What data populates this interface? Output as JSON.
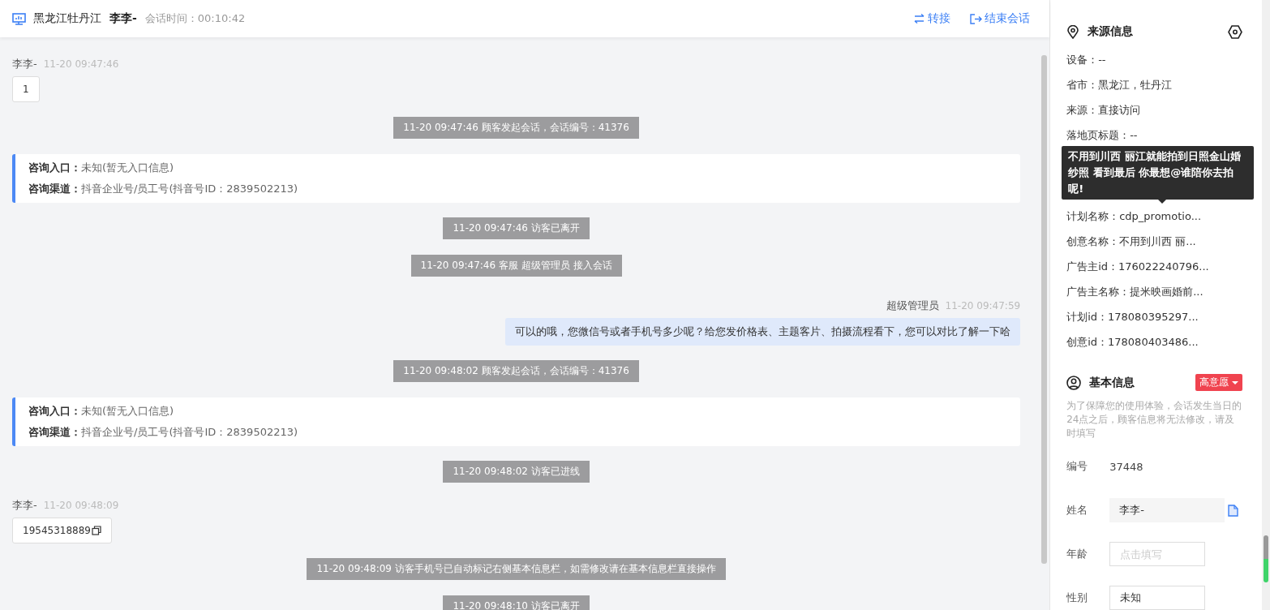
{
  "header": {
    "location": "黑龙江牡丹江",
    "visitor": "李李-",
    "duration_label": "会话时间：",
    "duration": "00:10:42",
    "actions": [
      {
        "kind": "transfer",
        "label": "转接"
      },
      {
        "kind": "end",
        "label": "结束会话"
      }
    ]
  },
  "messages": [
    {
      "kind": "visitor",
      "name": "李李-",
      "time": "11-20 09:47:46",
      "text": "1"
    },
    {
      "kind": "system",
      "text": "11-20 09:47:46 顾客发起会话，会话编号：41376"
    },
    {
      "kind": "info",
      "lines": [
        {
          "label": "咨询入口：",
          "value": "未知(暂无入口信息)"
        },
        {
          "label": "咨询渠道：",
          "value": "抖音企业号/员工号(抖音号ID：2839502213)"
        }
      ]
    },
    {
      "kind": "system",
      "text": "11-20 09:47:46 访客已离开"
    },
    {
      "kind": "system",
      "text": "11-20 09:47:46 客服 超级管理员 接入会话"
    },
    {
      "kind": "agent",
      "name": "超级管理员",
      "time": "11-20 09:47:59",
      "text": "可以的哦，您微信号或者手机号多少呢？给您发价格表、主题客片、拍摄流程看下，您可以对比了解一下哈"
    },
    {
      "kind": "system",
      "text": "11-20 09:48:02 顾客发起会话，会话编号：41376"
    },
    {
      "kind": "info",
      "lines": [
        {
          "label": "咨询入口：",
          "value": "未知(暂无入口信息)"
        },
        {
          "label": "咨询渠道：",
          "value": "抖音企业号/员工号(抖音号ID：2839502213)"
        }
      ]
    },
    {
      "kind": "system",
      "text": "11-20 09:48:02 访客已进线"
    },
    {
      "kind": "visitor",
      "name": "李李-",
      "time": "11-20 09:48:09",
      "text": "19545318889",
      "copy": true
    },
    {
      "kind": "system",
      "text": "11-20 09:48:09 访客手机号已自动标记右侧基本信息栏，如需修改请在基本信息栏直接操作"
    },
    {
      "kind": "system",
      "text": "11-20 09:48:10 访客已离开"
    }
  ],
  "source_info": {
    "title": "来源信息",
    "rows": [
      {
        "kind": "text",
        "text": "设备：--"
      },
      {
        "kind": "text",
        "text": "省市：黑龙江，牡丹江"
      },
      {
        "kind": "text",
        "text": "来源：直接访问"
      },
      {
        "kind": "text",
        "text": "落地页标题：--"
      },
      {
        "kind": "tooltip"
      },
      {
        "kind": "text",
        "text": "计划名称：cdp_promotio..."
      },
      {
        "kind": "text",
        "text": "创意名称：不用到川西 丽..."
      },
      {
        "kind": "text",
        "text": "广告主id：176022240796..."
      },
      {
        "kind": "text",
        "text": "广告主名称：提米映画婚前..."
      },
      {
        "kind": "text",
        "text": "计划id：178080395297..."
      },
      {
        "kind": "text",
        "text": "创意id：178080403486..."
      }
    ],
    "tooltip": "不用到川西 丽江就能拍到日照金山婚纱照 看到最后 你最想@谁陪你去拍呢!"
  },
  "basic_info": {
    "title": "基本信息",
    "intent_tag": "高意愿",
    "notice": "为了保障您的使用体验，会话发生当日的24点之后，顾客信息将无法修改，请及时填写",
    "fields": [
      {
        "kind": "static",
        "label": "编号",
        "value": "37448"
      },
      {
        "kind": "filled",
        "label": "姓名",
        "value": "李李-",
        "copy": true
      },
      {
        "kind": "input",
        "label": "年龄",
        "placeholder": "点击填写"
      },
      {
        "kind": "input",
        "label": "性别",
        "value": "未知"
      }
    ]
  }
}
